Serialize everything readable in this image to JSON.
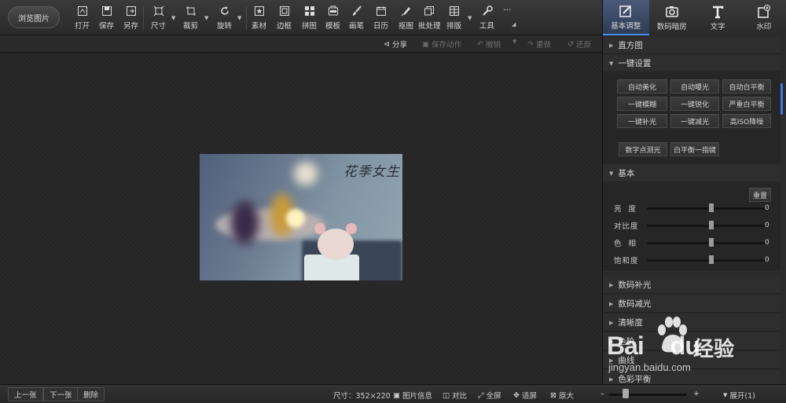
{
  "toolbar": {
    "browse": "浏览图片",
    "tools": [
      {
        "label": "打开",
        "icon": "open-icon"
      },
      {
        "label": "保存",
        "icon": "save-icon"
      },
      {
        "label": "另存",
        "icon": "save-as-icon"
      },
      {
        "label": "尺寸",
        "icon": "resize-icon"
      },
      {
        "label": "裁剪",
        "icon": "crop-icon"
      },
      {
        "label": "旋转",
        "icon": "rotate-icon"
      },
      {
        "label": "素材",
        "icon": "material-icon"
      },
      {
        "label": "边框",
        "icon": "border-icon"
      },
      {
        "label": "拼图",
        "icon": "collage-icon"
      },
      {
        "label": "模板",
        "icon": "template-icon"
      },
      {
        "label": "画笔",
        "icon": "brush-icon"
      },
      {
        "label": "日历",
        "icon": "calendar-icon"
      },
      {
        "label": "抠图",
        "icon": "cutout-icon"
      },
      {
        "label": "批处理",
        "icon": "batch-icon"
      },
      {
        "label": "排版",
        "icon": "layout-icon"
      },
      {
        "label": "工具",
        "icon": "wrench-icon"
      }
    ],
    "more": "···"
  },
  "actionbar": {
    "share": "分享",
    "save_action": "保存动作",
    "undo": "撤销",
    "redo": "重做",
    "restore": "还原"
  },
  "photo": {
    "title": "花季女生"
  },
  "statusbar": {
    "prev": "上一张",
    "next": "下一张",
    "delete": "删除",
    "size": "尺寸：352×220",
    "info": "图片信息",
    "compare": "对比",
    "fullscreen": "全屏",
    "fit": "适屏",
    "original": "原大",
    "minus": "–",
    "plus": "+",
    "expand": "展开(1)",
    "zoom_level": 0.2
  },
  "panel": {
    "tabs": [
      {
        "label": "基本调整",
        "icon": "adjust-icon"
      },
      {
        "label": "数码暗房",
        "icon": "darkroom-icon"
      },
      {
        "label": "文字",
        "icon": "text-icon"
      },
      {
        "label": "水印",
        "icon": "watermark-icon"
      }
    ],
    "histogram": "直方图",
    "one_click": "一键设置",
    "one_click_buttons": [
      "自动美化",
      "自动曝光",
      "自动白平衡",
      "一键模糊",
      "一键锐化",
      "严重白平衡",
      "一键补光",
      "一键减光",
      "高ISO降噪"
    ],
    "point_buttons": [
      "数字点测光",
      "白平衡一指键"
    ],
    "basic": "基本",
    "reset": "重置",
    "sliders": [
      {
        "label": "亮 度",
        "value": "0"
      },
      {
        "label": "对比度",
        "value": "0"
      },
      {
        "label": "色 相",
        "value": "0"
      },
      {
        "label": "饱和度",
        "value": "0"
      }
    ],
    "sections": [
      "数码补光",
      "数码减光",
      "清晰度",
      "色阶",
      "曲线",
      "色彩平衡"
    ]
  },
  "watermark": {
    "brand": "Bai",
    "brand2": "du",
    "text": "经验",
    "url": "jingyan.baidu.com"
  }
}
